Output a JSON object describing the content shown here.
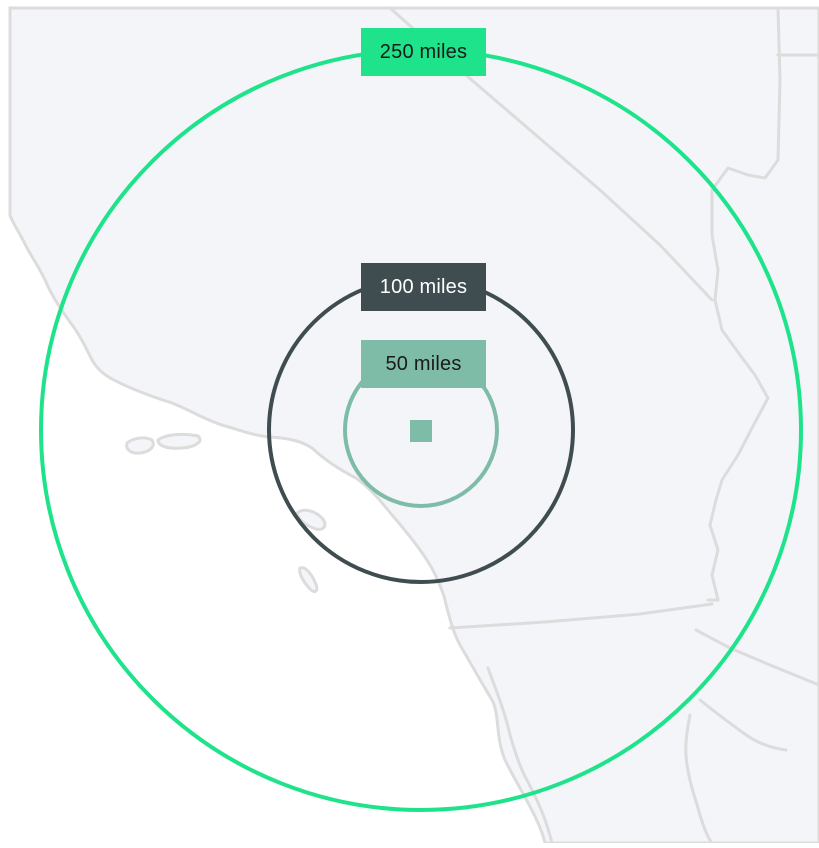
{
  "map": {
    "colors": {
      "land": "#f4f5f8",
      "ocean": "#ffffff",
      "borders": "#dcdcdc"
    },
    "center_marker": {
      "icon": "square-location-marker-icon",
      "color": "#7fbca8"
    }
  },
  "radius_rings": [
    {
      "radius_miles": 250,
      "label": "250 miles",
      "ring_color": "#1ee38b",
      "label_bg": "#1ee38b",
      "label_text_color": "#1a1a1a"
    },
    {
      "radius_miles": 100,
      "label": "100 miles",
      "ring_color": "#3f4c50",
      "label_bg": "#3f4c50",
      "label_text_color": "#ffffff"
    },
    {
      "radius_miles": 50,
      "label": "50 miles",
      "ring_color": "#7fbca8",
      "label_bg": "#7fbca8",
      "label_text_color": "#1a1a1a"
    }
  ]
}
